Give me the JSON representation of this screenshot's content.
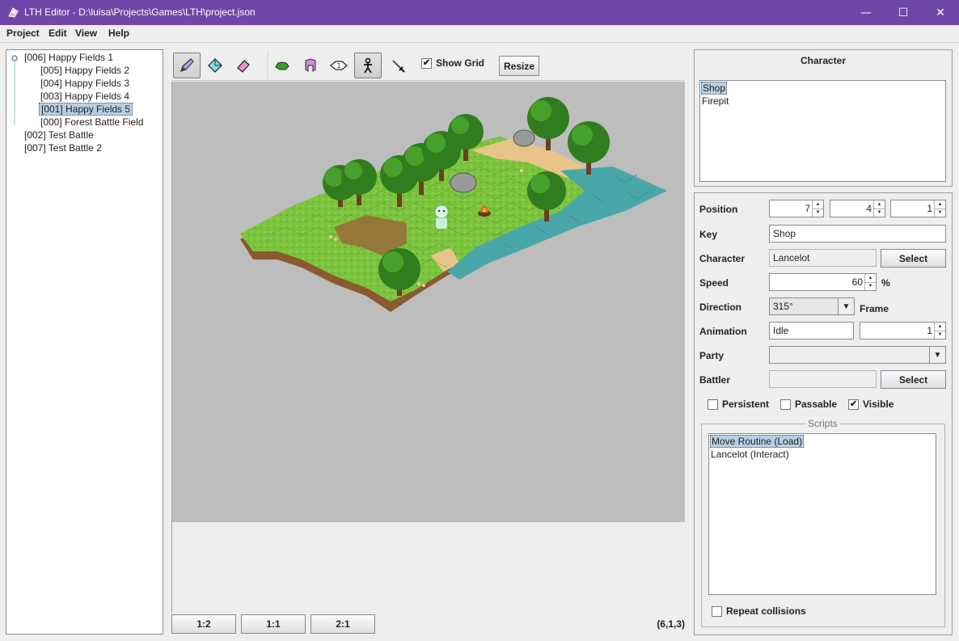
{
  "window": {
    "title": "LTH Editor - D:\\luisa\\Projects\\Games\\LTH\\project.json",
    "controls": {
      "minimize": "—",
      "maximize": "☐",
      "close": "✕"
    }
  },
  "menu": {
    "items": [
      "Project",
      "Edit",
      "View",
      "Help"
    ]
  },
  "tree": {
    "items": [
      {
        "label": "[006] Happy Fields 1",
        "level": 0,
        "expanded": true
      },
      {
        "label": "[005] Happy Fields 2",
        "level": 1
      },
      {
        "label": "[004] Happy Fields 3",
        "level": 1
      },
      {
        "label": "[003] Happy Fields 4",
        "level": 1
      },
      {
        "label": "[001] Happy Fields 5",
        "level": 1,
        "selected": true
      },
      {
        "label": "[000] Forest Battle Field",
        "level": 1
      },
      {
        "label": "[002] Test Battle",
        "level": 0
      },
      {
        "label": "[007] Test Battle 2",
        "level": 0
      }
    ]
  },
  "toolbar": {
    "tools": [
      "pencil-icon",
      "bucket-icon",
      "eraser-icon",
      "terrain-icon",
      "obstacle-icon",
      "region-icon",
      "character-icon",
      "battler-icon"
    ],
    "active_tool": "character-icon",
    "show_grid_label": "Show Grid",
    "show_grid_checked": true,
    "resize_label": "Resize"
  },
  "zoom": {
    "buttons": [
      "1:2",
      "1:1",
      "2:1"
    ],
    "coords": "(6,1,3)"
  },
  "character_panel": {
    "header": "Character",
    "list": [
      "Shop",
      "Firepit"
    ],
    "selected": "Shop"
  },
  "props": {
    "position_label": "Position",
    "position": {
      "x": "7",
      "y": "4",
      "z": "1"
    },
    "key_label": "Key",
    "key": "Shop",
    "character_label": "Character",
    "character": "Lancelot",
    "select_label": "Select",
    "speed_label": "Speed",
    "speed": "60",
    "speed_unit": "%",
    "direction_label": "Direction",
    "direction": "315°",
    "frame_label": "Frame",
    "animation_label": "Animation",
    "animation": "Idle",
    "frame": "1",
    "party_label": "Party",
    "party": "",
    "battler_label": "Battler",
    "battler": "",
    "persistent_label": "Persistent",
    "passable_label": "Passable",
    "visible_label": "Visible",
    "persistent": false,
    "passable": false,
    "visible": true,
    "scripts_title": "Scripts",
    "scripts": [
      "Move Routine (Load)",
      "Lancelot (Interact)"
    ],
    "selected_script": "Move Routine (Load)",
    "repeat_label": "Repeat collisions",
    "repeat": false
  },
  "colors": {
    "titlebar": "#7046a8",
    "selection": "#b8cfe5",
    "canvas": "#bdbdbd",
    "grass": "#7cc43e",
    "water": "#4aa7a9",
    "sand": "#e8c48a"
  }
}
